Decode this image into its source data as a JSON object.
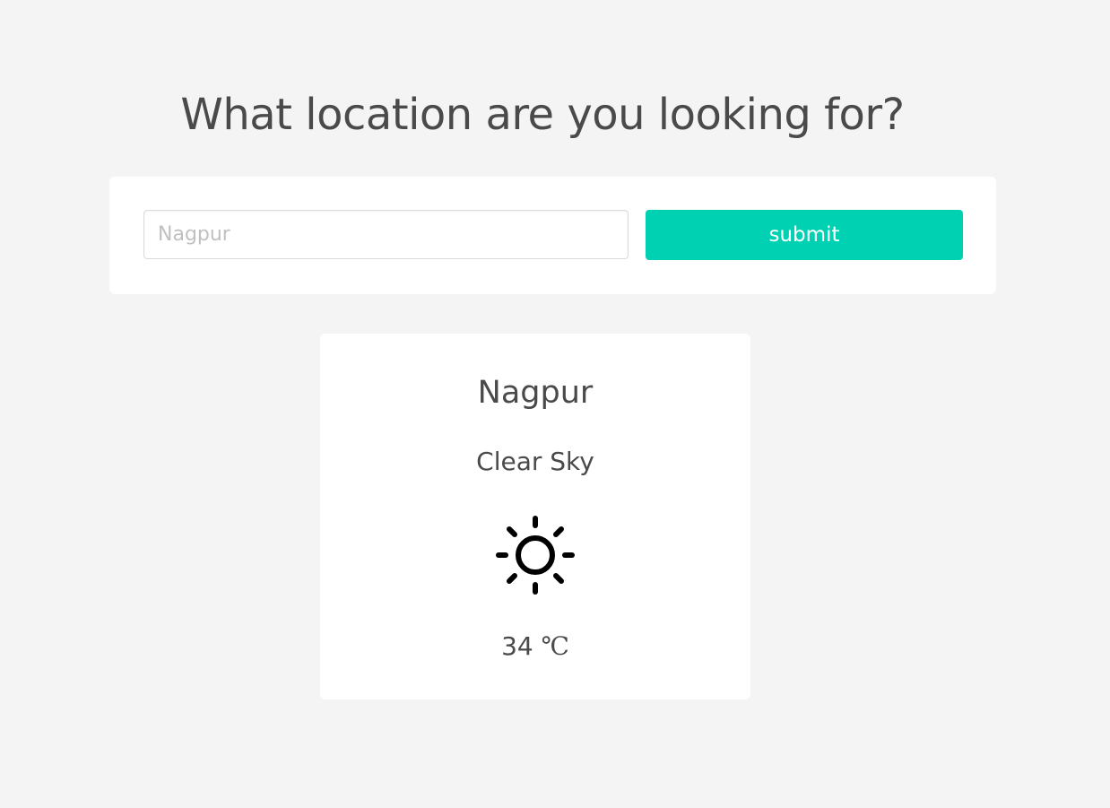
{
  "header": {
    "title": "What location are you looking for?"
  },
  "search": {
    "placeholder": "Nagpur",
    "value": "",
    "submit_label": "submit"
  },
  "weather": {
    "city": "Nagpur",
    "condition": "Clear Sky",
    "icon": "sun-icon",
    "temperature": "34",
    "unit": "℃"
  },
  "colors": {
    "background": "#f4f4f4",
    "accent": "#00d1b2",
    "text": "#4a4a4a"
  }
}
